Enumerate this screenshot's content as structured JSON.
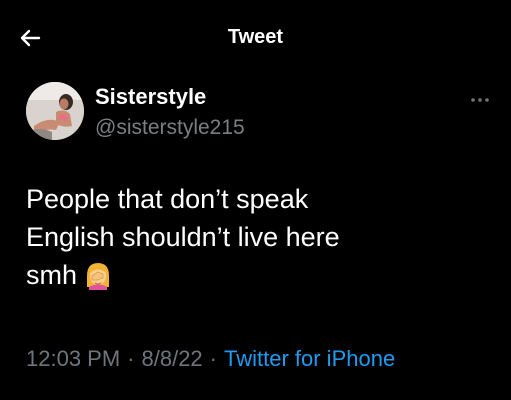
{
  "header": {
    "title": "Tweet",
    "back_icon": "arrow-left-icon"
  },
  "author": {
    "display_name": "Sisterstyle",
    "handle": "@sisterstyle215",
    "avatar": "profile-photo",
    "more_icon": "more-horizontal-icon"
  },
  "tweet": {
    "lines": [
      "People that don’t speak",
      "English shouldn’t live here",
      "smh"
    ],
    "emoji": "woman-facepalming-emoji"
  },
  "meta": {
    "time": "12:03 PM",
    "separator": "·",
    "date": "8/8/22",
    "source": "Twitter for iPhone"
  },
  "colors": {
    "background": "#000000",
    "primary_text": "#ffffff",
    "secondary_text": "#6e767d",
    "link": "#1d9bf0"
  }
}
